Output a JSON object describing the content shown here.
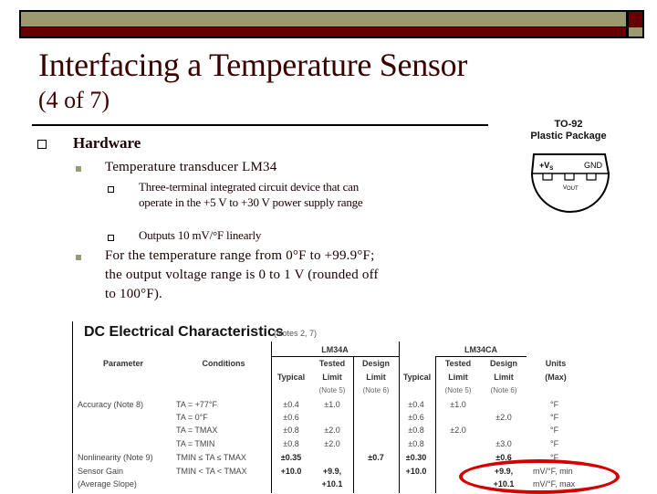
{
  "slide": {
    "title": "Interfacing a Temperature Sensor",
    "subtitle": "(4 of 7)",
    "accent_colors": {
      "olive": "#9a9a6c",
      "maroon": "#660000",
      "title_text": "#3a0000"
    },
    "bullets": {
      "l1": "Hardware",
      "l2_a": "Temperature transducer LM34",
      "l3_a": "Three-terminal integrated circuit device that can operate in the +5 V to +30 V power supply range",
      "l3_b": "Outputs 10 mV/°F linearly",
      "l2_b": "For the temperature range from 0°F to +99.9°F; the output voltage range is 0 to 1 V (rounded off to 100°F)."
    }
  },
  "package": {
    "title_line1": "TO-92",
    "title_line2": "Plastic Package",
    "pin_left": "+V",
    "pin_left_sub": "S",
    "pin_right": "GND",
    "pin_mid": "V",
    "pin_mid_sub": "OUT"
  },
  "datasheet": {
    "title": "DC Electrical Characteristics",
    "notes": "(Notes 2, 7)",
    "headers": {
      "parameter": "Parameter",
      "conditions": "Conditions",
      "group_a": "LM34A",
      "group_ca": "LM34CA",
      "typical": "Typical",
      "tested": "Tested",
      "design": "Design",
      "limit": "Limit",
      "note5": "(Note 5)",
      "note6": "(Note 6)",
      "units": "Units",
      "units_max": "(Max)"
    },
    "rows": [
      {
        "param": "Accuracy (Note 8)",
        "cond": "TA = +77°F",
        "a_typ": "±0.4",
        "a_tested": "±1.0",
        "a_design": "",
        "ca_typ": "±0.4",
        "ca_tested": "±1.0",
        "ca_design": "",
        "units": "°F"
      },
      {
        "param": "",
        "cond": "TA = 0°F",
        "a_typ": "±0.6",
        "a_tested": "",
        "a_design": "",
        "ca_typ": "±0.6",
        "ca_tested": "",
        "ca_design": "±2.0",
        "units": "°F"
      },
      {
        "param": "",
        "cond": "TA = TMAX",
        "a_typ": "±0.8",
        "a_tested": "±2.0",
        "a_design": "",
        "ca_typ": "±0.8",
        "ca_tested": "±2.0",
        "ca_design": "",
        "units": "°F"
      },
      {
        "param": "",
        "cond": "TA = TMIN",
        "a_typ": "±0.8",
        "a_tested": "±2.0",
        "a_design": "",
        "ca_typ": "±0.8",
        "ca_tested": "",
        "ca_design": "±3.0",
        "units": "°F"
      },
      {
        "param": "Nonlinearity (Note 9)",
        "cond": "TMIN ≤ TA ≤ TMAX",
        "a_typ": "±0.35",
        "a_tested": "",
        "a_design": "±0.7",
        "ca_typ": "±0.30",
        "ca_tested": "",
        "ca_design": "±0.6",
        "units": "°F"
      },
      {
        "param": "Sensor Gain",
        "cond": "TMIN < TA < TMAX",
        "a_typ": "+10.0",
        "a_tested": "+9.9,",
        "a_design": "",
        "ca_typ": "+10.0",
        "ca_tested": "",
        "ca_design": "+9.9,",
        "units": "mV/°F, min"
      },
      {
        "param": "(Average Slope)",
        "cond": "",
        "a_typ": "",
        "a_tested": "+10.1",
        "a_design": "",
        "ca_typ": "",
        "ca_tested": "",
        "ca_design": "+10.1",
        "units": "mV/°F, max"
      }
    ],
    "highlight_color": "#d40000"
  }
}
